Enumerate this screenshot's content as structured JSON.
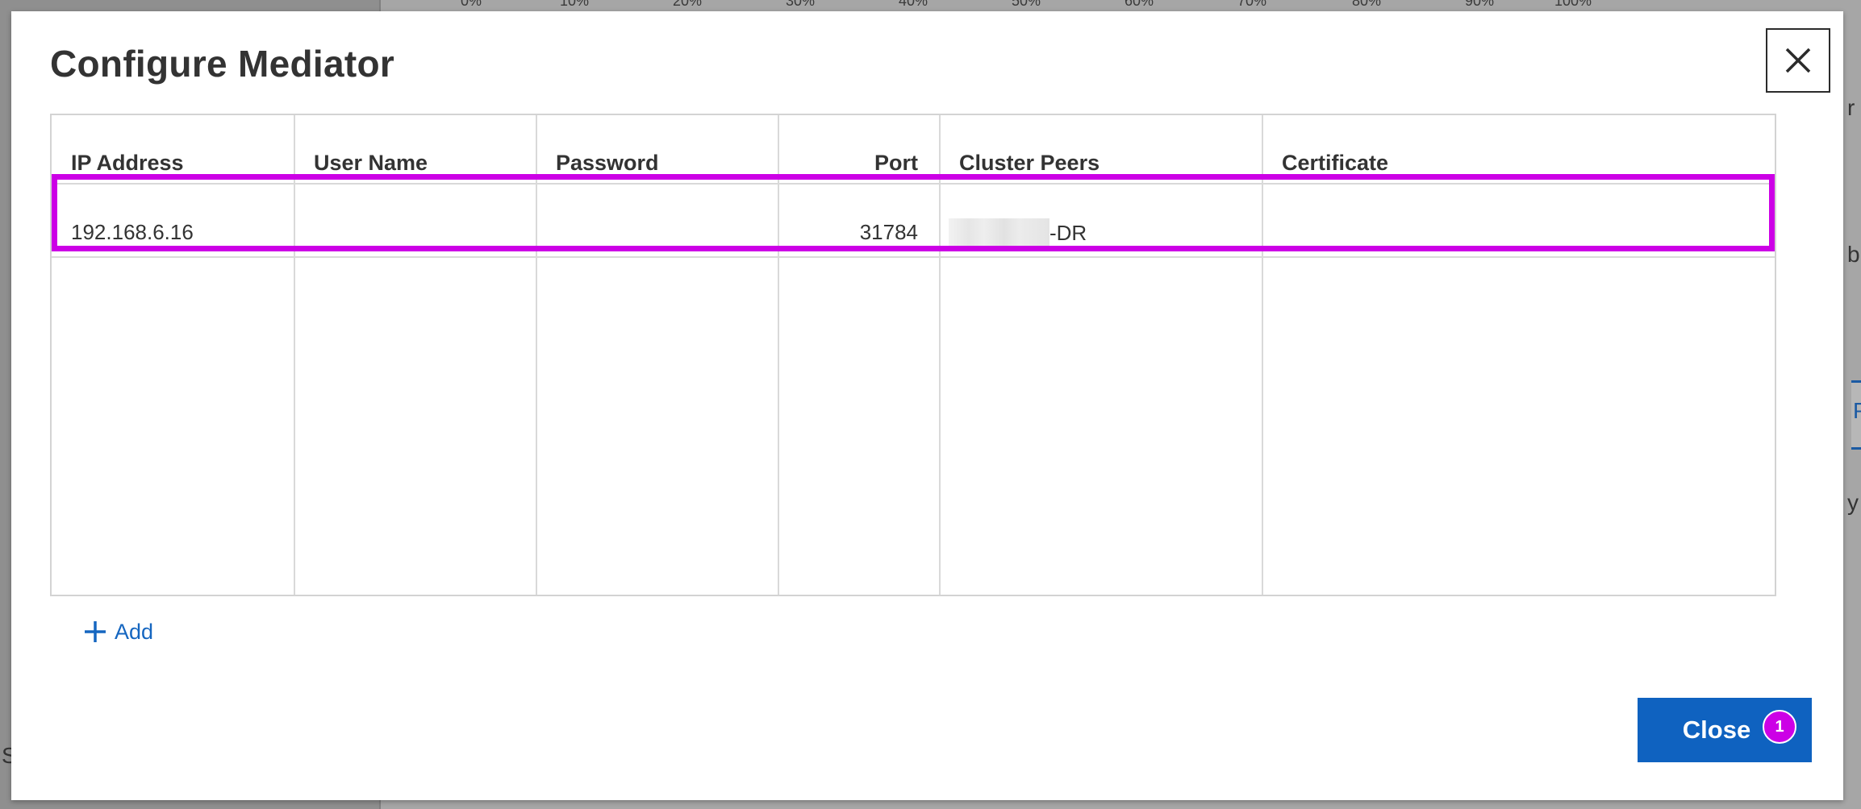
{
  "background": {
    "axis_ticks": [
      "0%",
      "10%",
      "20%",
      "30%",
      "40%",
      "50%",
      "60%",
      "70%",
      "80%",
      "90%",
      "100%"
    ],
    "right_fragments": [
      "r",
      "b",
      "P",
      "y"
    ],
    "left_fragment": "S"
  },
  "dialog": {
    "title": "Configure Mediator",
    "close_icon": "close-icon"
  },
  "table": {
    "columns": [
      "IP Address",
      "User Name",
      "Password",
      "Port",
      "Cluster Peers",
      "Certificate"
    ],
    "rows": [
      {
        "ip_address": "192.168.6.16",
        "user_name": "",
        "password": "",
        "port": "31784",
        "cluster_peers_suffix": "-DR",
        "certificate": ""
      }
    ]
  },
  "actions": {
    "add_label": "Add",
    "add_icon": "plus-icon",
    "close_label": "Close",
    "step_badge": "1"
  },
  "colors": {
    "accent": "#0f62c0",
    "highlight": "#cc00e6",
    "link": "#1566c0"
  }
}
